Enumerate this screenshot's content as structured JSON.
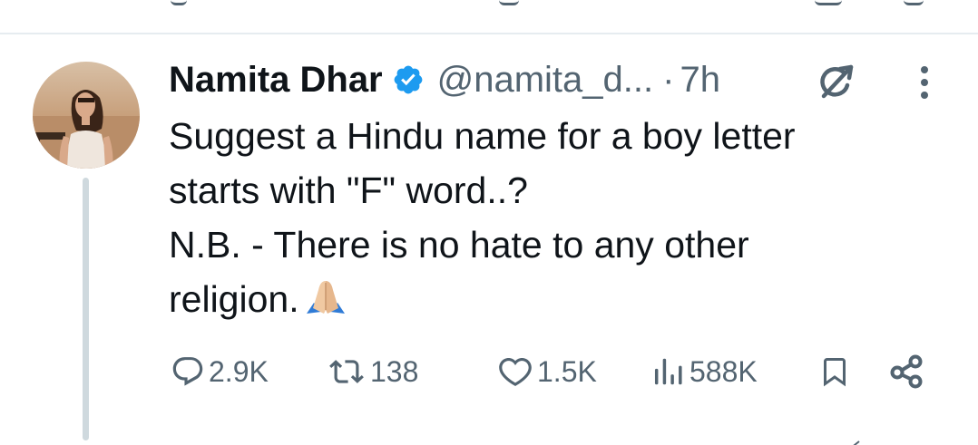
{
  "tweet": {
    "author_name": "Namita Dhar",
    "handle": "@namita_d...",
    "separator": "·",
    "time": "7h",
    "text_lines": [
      "Suggest a Hindu name for a boy letter",
      "starts with \"F\" word..?",
      "N.B. - There is no hate to any other",
      "religion."
    ],
    "emoji": "folded-hands-emoji"
  },
  "actions": {
    "replies": "2.9K",
    "reposts": "138",
    "likes": "1.5K",
    "views": "588K"
  },
  "icons": {
    "verified": "verified-badge-icon",
    "grok": "grok-icon",
    "more": "more-vertical-icon",
    "reply": "reply-icon",
    "repost": "repost-icon",
    "like": "heart-icon",
    "views": "views-chart-icon",
    "bookmark": "bookmark-icon",
    "share": "share-icon"
  },
  "colors": {
    "text": "#0f1419",
    "secondary": "#536471",
    "verified": "#1d9bf0",
    "divider": "#e6ecf0",
    "thread_line": "#cfd9de"
  }
}
